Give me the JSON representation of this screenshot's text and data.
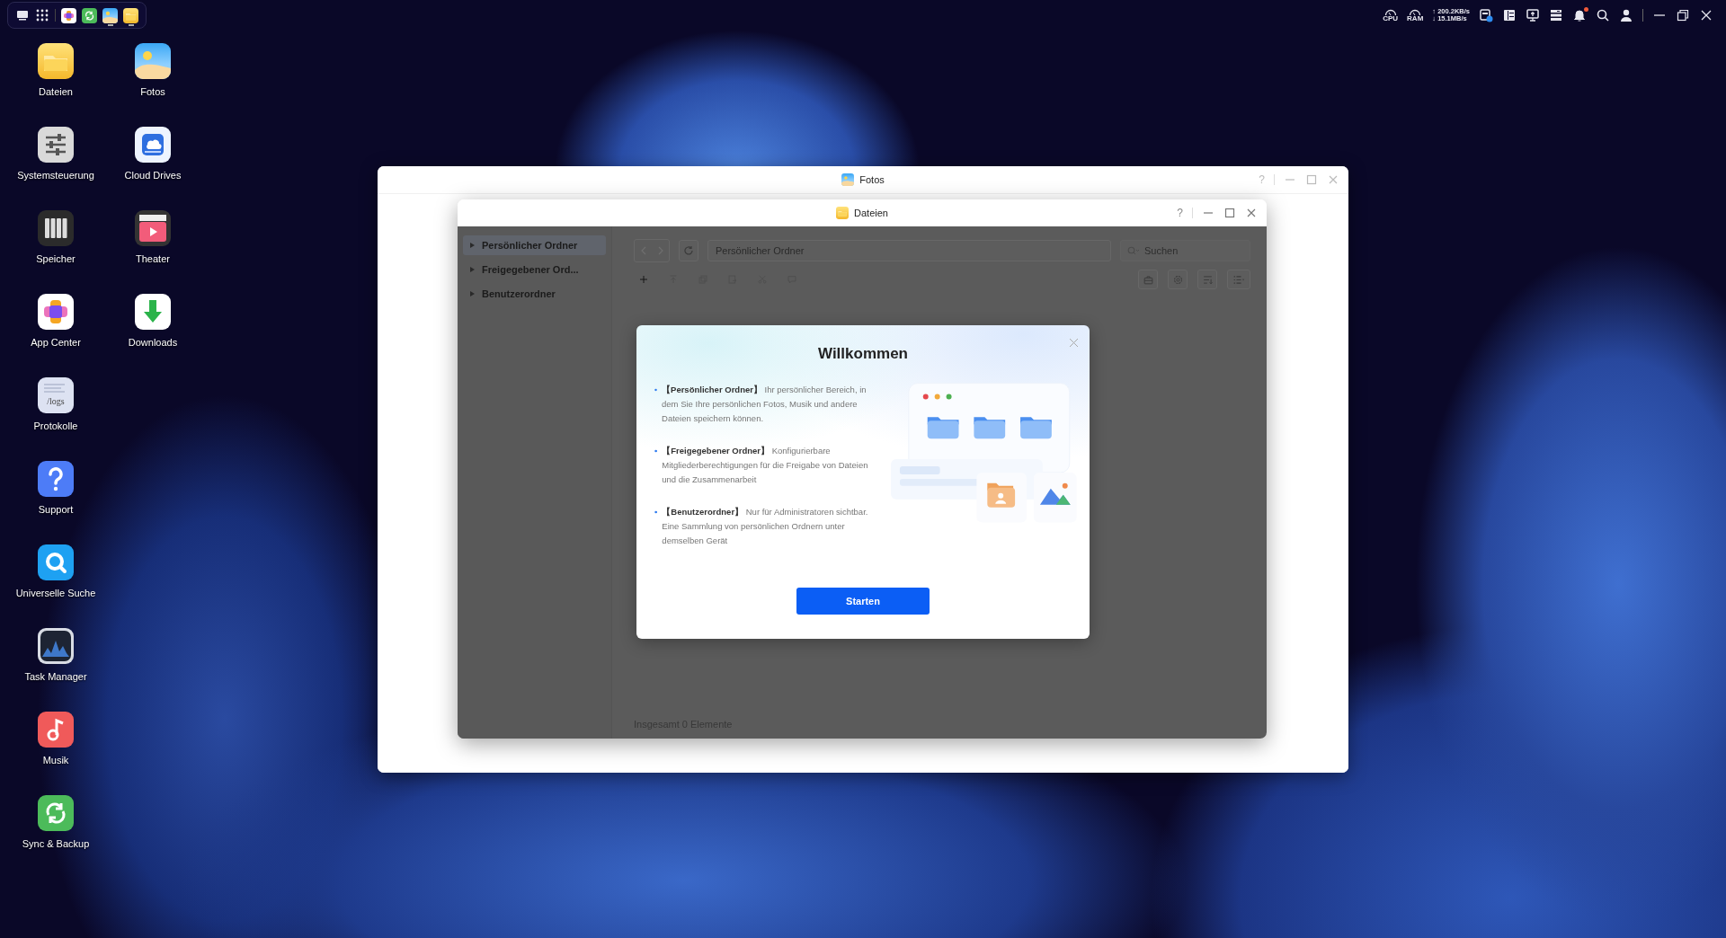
{
  "dock": {
    "apps": [
      {
        "kind": "appcenter",
        "running": false
      },
      {
        "kind": "sync",
        "running": false
      },
      {
        "kind": "photos",
        "running": true
      },
      {
        "kind": "files",
        "running": true
      }
    ]
  },
  "system_tray": {
    "cpu_label": "CPU",
    "ram_label": "RAM",
    "upload_speed": "↑ 200.2KB/s",
    "download_speed": "↓ 15.1MB/s",
    "notifications_unread": true
  },
  "desktop_icon_rows": [
    [
      {
        "label": "Dateien",
        "kind": "files"
      },
      {
        "label": "Fotos",
        "kind": "photos"
      }
    ],
    [
      {
        "label": "Systemsteuerung",
        "kind": "settings"
      },
      {
        "label": "Cloud Drives",
        "kind": "cloud"
      }
    ],
    [
      {
        "label": "Speicher",
        "kind": "storage"
      },
      {
        "label": "Theater",
        "kind": "theater"
      }
    ],
    [
      {
        "label": "App Center",
        "kind": "appcenter"
      },
      {
        "label": "Downloads",
        "kind": "downloads"
      }
    ],
    [
      {
        "label": "Protokolle",
        "kind": "logs",
        "icon_text": "/logs"
      }
    ],
    [
      {
        "label": "Support",
        "kind": "support"
      }
    ],
    [
      {
        "label": "Universelle Suche",
        "kind": "search"
      }
    ],
    [
      {
        "label": "Task Manager",
        "kind": "taskmanager"
      }
    ],
    [
      {
        "label": "Musik",
        "kind": "music"
      }
    ],
    [
      {
        "label": "Sync & Backup",
        "kind": "sync"
      }
    ]
  ],
  "photos_window": {
    "title": "Fotos",
    "help_button": "?"
  },
  "files_window": {
    "title": "Dateien",
    "help_button": "?",
    "sidebar": {
      "items": [
        {
          "label": "Persönlicher Ordner",
          "selected": true,
          "expanded": false
        },
        {
          "label": "Freigegebener Ord...",
          "selected": false,
          "expanded": false
        },
        {
          "label": "Benutzerordner",
          "selected": false,
          "expanded": false
        }
      ]
    },
    "toolbar": {
      "back": {
        "disabled": true
      },
      "forward": {
        "disabled": true
      },
      "path": "Persönlicher Ordner",
      "search": {
        "placeholder": "Suchen"
      },
      "actions": [
        {
          "kind": "new",
          "disabled": false
        },
        {
          "kind": "upload",
          "disabled": true
        },
        {
          "kind": "copy",
          "disabled": true
        },
        {
          "kind": "move",
          "disabled": true
        },
        {
          "kind": "cut",
          "disabled": true
        },
        {
          "kind": "comment",
          "disabled": true
        }
      ],
      "view_actions": [
        {
          "kind": "toolbox"
        },
        {
          "kind": "settings"
        },
        {
          "kind": "sort"
        },
        {
          "kind": "view"
        }
      ]
    },
    "status_bar": "Insgesamt 0 Elemente",
    "welcome_dialog": {
      "title": "Willkommen",
      "items": [
        "**【Persönlicher Ordner】** Ihr persönlicher Bereich, in dem Sie Ihre persönlichen Fotos, Musik und andere Dateien speichern können.",
        "**【Freigegebener Ordner】** Konfigurierbare Mitgliederberechtigungen für die Freigabe von Dateien und die Zusammenarbeit",
        "**【Benutzerordner】** Nur für Administratoren sichtbar. Eine Sammlung von persönlichen Ordnern unter demselben Gerät"
      ],
      "button": "Starten"
    }
  }
}
